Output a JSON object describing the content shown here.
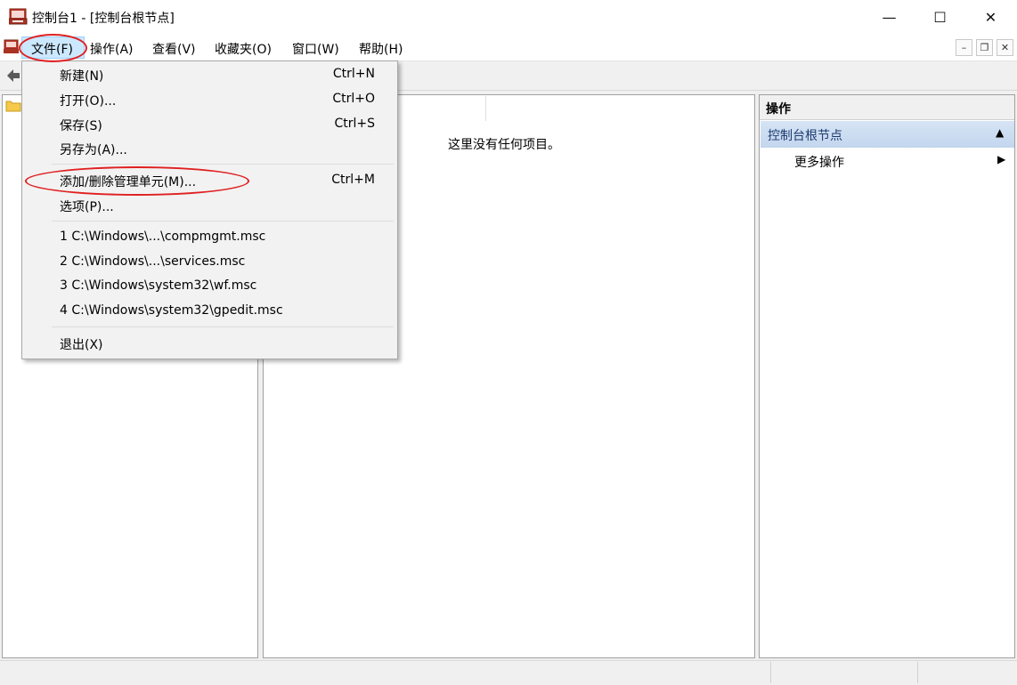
{
  "window": {
    "title": "控制台1 - [控制台根节点]",
    "minimize_glyph": "—",
    "maximize_glyph": "☐",
    "close_glyph": "✕"
  },
  "menubar": {
    "items": [
      "文件(F)",
      "操作(A)",
      "查看(V)",
      "收藏夹(O)",
      "窗口(W)",
      "帮助(H)"
    ],
    "mdi_minimize": "–",
    "mdi_restore": "❐",
    "mdi_close": "✕"
  },
  "toolbar": {
    "back_icon": "back-arrow-icon"
  },
  "center": {
    "empty_message": "这里没有任何项目。"
  },
  "actions": {
    "header": "操作",
    "section_title": "控制台根节点",
    "more": "更多操作",
    "collapse_glyph": "▲",
    "more_glyph": "▶"
  },
  "file_menu": {
    "items": [
      {
        "label": "新建(N)",
        "shortcut": "Ctrl+N"
      },
      {
        "label": "打开(O)...",
        "shortcut": "Ctrl+O"
      },
      {
        "label": "保存(S)",
        "shortcut": "Ctrl+S"
      },
      {
        "label": "另存为(A)...",
        "shortcut": ""
      },
      {
        "label": "添加/删除管理单元(M)...",
        "shortcut": "Ctrl+M"
      },
      {
        "label": "选项(P)...",
        "shortcut": ""
      },
      {
        "label": "1 C:\\Windows\\...\\compmgmt.msc",
        "shortcut": ""
      },
      {
        "label": "2 C:\\Windows\\...\\services.msc",
        "shortcut": ""
      },
      {
        "label": "3 C:\\Windows\\system32\\wf.msc",
        "shortcut": ""
      },
      {
        "label": "4 C:\\Windows\\system32\\gpedit.msc",
        "shortcut": ""
      },
      {
        "label": "退出(X)",
        "shortcut": ""
      }
    ]
  },
  "colors": {
    "annotation": "#e02020",
    "menu_highlight": "#cce8ff",
    "actions_section": "#c3d6ee"
  }
}
